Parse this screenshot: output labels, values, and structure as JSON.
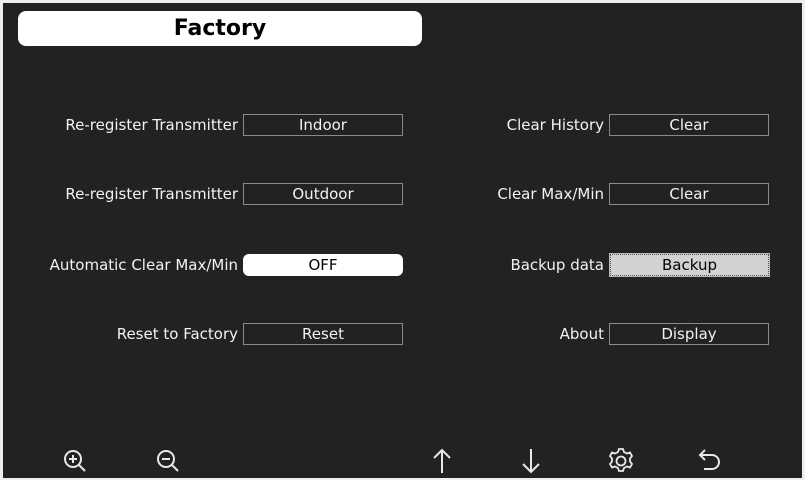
{
  "title": "Factory",
  "left_rows": [
    {
      "label": "Re-register Transmitter",
      "button": "Indoor"
    },
    {
      "label": "Re-register Transmitter",
      "button": "Outdoor"
    },
    {
      "label": "Automatic Clear Max/Min",
      "button": "OFF"
    },
    {
      "label": "Reset to Factory",
      "button": "Reset"
    }
  ],
  "right_rows": [
    {
      "label": "Clear History",
      "button": "Clear"
    },
    {
      "label": "Clear Max/Min",
      "button": "Clear"
    },
    {
      "label": "Backup data",
      "button": "Backup"
    },
    {
      "label": "About",
      "button": "Display"
    }
  ],
  "toolbar": {
    "icons": [
      "zoom-in-icon",
      "zoom-out-icon",
      "arrow-up-icon",
      "arrow-down-icon",
      "gear-icon",
      "back-icon"
    ]
  },
  "colors": {
    "background": "#222222",
    "title_bar": "#ffffff",
    "button_border": "#8a8a8a",
    "selected_button": "#d2d2d2"
  }
}
